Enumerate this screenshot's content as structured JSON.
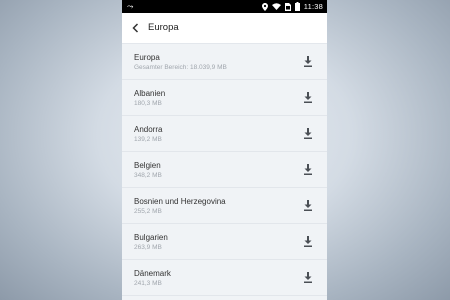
{
  "status_bar": {
    "time": "11:38"
  },
  "app_bar": {
    "title": "Europa"
  },
  "regions": [
    {
      "name": "Europa",
      "size": "Gesamter Bereich: 18.039,9 MB"
    },
    {
      "name": "Albanien",
      "size": "180,3 MB"
    },
    {
      "name": "Andorra",
      "size": "139,2 MB"
    },
    {
      "name": "Belgien",
      "size": "348,2 MB"
    },
    {
      "name": "Bosnien und Herzegovina",
      "size": "255,2 MB"
    },
    {
      "name": "Bulgarien",
      "size": "263,9 MB"
    },
    {
      "name": "Dänemark",
      "size": "241,3 MB"
    }
  ],
  "icons": {
    "back": "arrow-left-icon",
    "download": "download-icon",
    "location": "location-icon",
    "wifi": "wifi-icon",
    "sim": "sim-icon",
    "battery": "battery-icon"
  }
}
